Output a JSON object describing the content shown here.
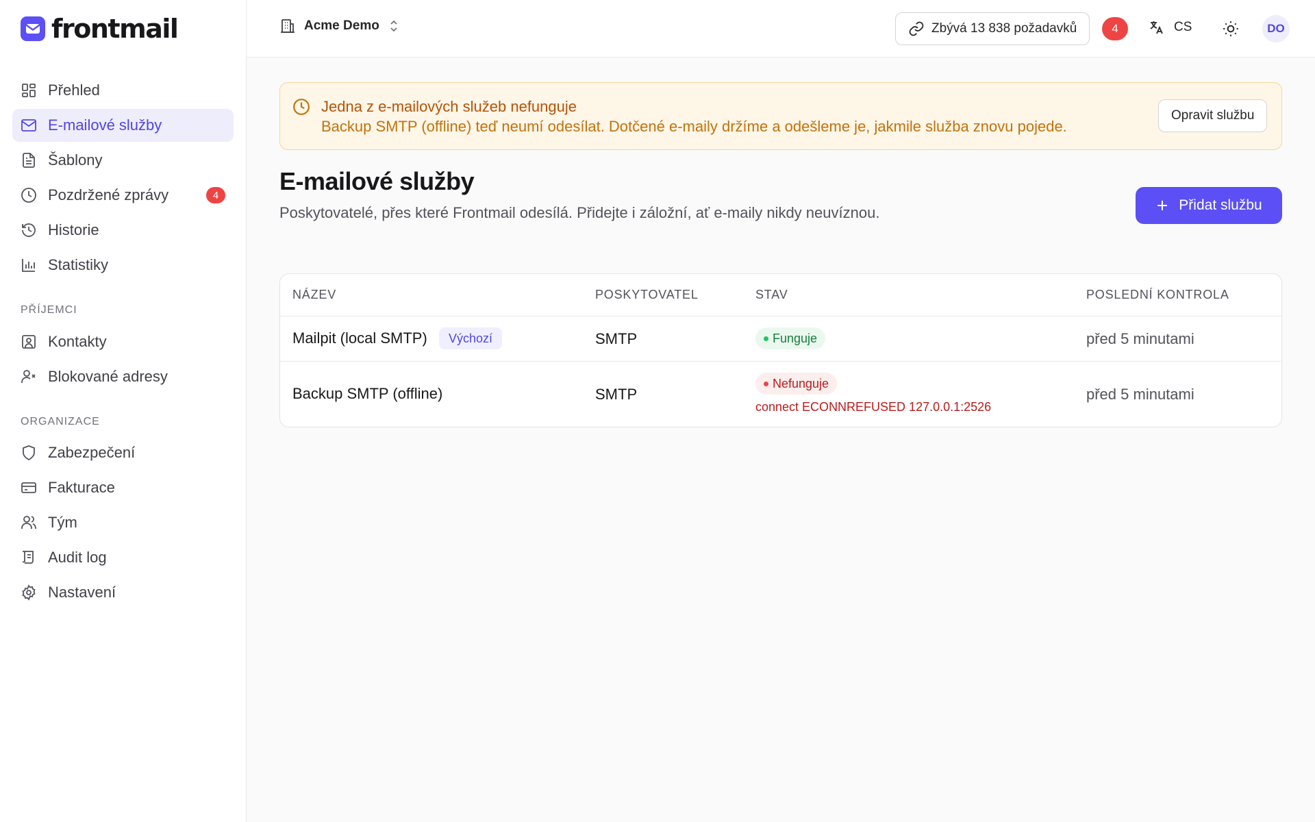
{
  "brand": {
    "name": "frontmail",
    "accent": "#5b4ff5"
  },
  "sidebar": {
    "items": [
      {
        "label": "Přehled",
        "icon": "dashboard-icon"
      },
      {
        "label": "E-mailové služby",
        "icon": "mail-icon",
        "active": true
      },
      {
        "label": "Šablony",
        "icon": "document-icon"
      },
      {
        "label": "Pozdržené zprávy",
        "icon": "clock-icon",
        "badge": "4"
      },
      {
        "label": "Historie",
        "icon": "history-icon"
      },
      {
        "label": "Statistiky",
        "icon": "bar-chart-icon"
      }
    ],
    "recipients_title": "PŘÍJEMCI",
    "recipients": [
      {
        "label": "Kontakty",
        "icon": "contact-icon"
      },
      {
        "label": "Blokované adresy",
        "icon": "user-x-icon"
      }
    ],
    "org_title": "ORGANIZACE",
    "org": [
      {
        "label": "Zabezpečení",
        "icon": "shield-icon"
      },
      {
        "label": "Fakturace",
        "icon": "credit-card-icon"
      },
      {
        "label": "Tým",
        "icon": "users-icon"
      },
      {
        "label": "Audit log",
        "icon": "scroll-icon"
      },
      {
        "label": "Nastavení",
        "icon": "gear-icon"
      }
    ]
  },
  "topbar": {
    "org_name": "Acme Demo",
    "quota": "Zbývá 13 838 požadavků",
    "notifications": "4",
    "language": "CS",
    "avatar": "DO"
  },
  "alert": {
    "title": "Jedna z e-mailových služeb nefunguje",
    "description": "Backup SMTP (offline) teď neumí odesílat. Dotčené e-maily držíme a odešleme je, jakmile služba znovu pojede.",
    "button": "Opravit službu"
  },
  "page": {
    "title": "E-mailové služby",
    "subtitle": "Poskytovatelé, přes které Frontmail odesílá. Přidejte i záložní, ať e-maily nikdy neuvíznou.",
    "add_button": "Přidat službu"
  },
  "table": {
    "headers": [
      "NÁZEV",
      "POSKYTOVATEL",
      "STAV",
      "POSLEDNÍ KONTROLA"
    ],
    "rows": [
      {
        "name": "Mailpit (local SMTP)",
        "badge": "Výchozí",
        "provider": "SMTP",
        "status": "Funguje",
        "last_check": "před 5 minutami"
      },
      {
        "name": "Backup SMTP (offline)",
        "provider": "SMTP",
        "status": "Nefunguje",
        "error": "connect ECONNREFUSED 127.0.0.1:2526",
        "last_check": "před 5 minutami"
      }
    ]
  }
}
